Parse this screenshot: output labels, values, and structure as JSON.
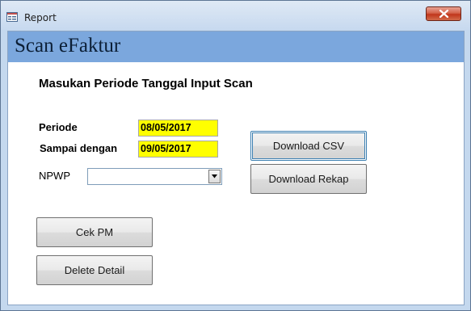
{
  "window": {
    "title": "Report",
    "icon": "report-form-icon",
    "close_icon": "close-icon"
  },
  "form": {
    "header_title": "Scan eFaktur",
    "subtitle": "Masukan Periode Tanggal Input Scan",
    "periode_label": "Periode",
    "periode_value": "08/05/2017",
    "sampai_label": "Sampai dengan",
    "sampai_value": "09/05/2017",
    "npwp_label": "NPWP",
    "npwp_value": ""
  },
  "buttons": {
    "download_csv": "Download CSV",
    "download_rekap": "Download Rekap",
    "cek_pm": "Cek PM",
    "delete_detail": "Delete Detail"
  },
  "colors": {
    "header_band": "#7ba7dd",
    "date_field_bg": "#ffff00",
    "window_frame": "#c4d8ee",
    "close_button": "#c1361b"
  }
}
